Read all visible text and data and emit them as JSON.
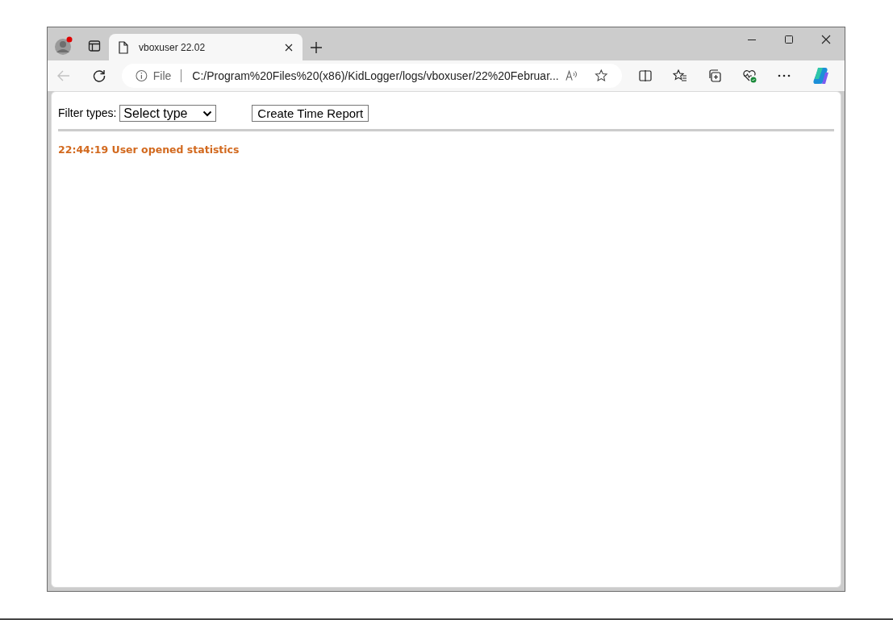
{
  "browser": {
    "tabs": [
      {
        "title": "vboxuser 22.02",
        "selected": true
      }
    ],
    "back_disabled": true,
    "address": {
      "scheme": "File",
      "url": "C:/Program%20Files%20(x86)/KidLogger/logs/vboxuser/22%20Februar..."
    }
  },
  "page": {
    "filter_label": "Filter types:",
    "filter_select": "Select type",
    "report_button": "Create Time Report",
    "entries": [
      {
        "text": "22:44:19 User opened statistics",
        "color": "#d2691e"
      }
    ]
  }
}
